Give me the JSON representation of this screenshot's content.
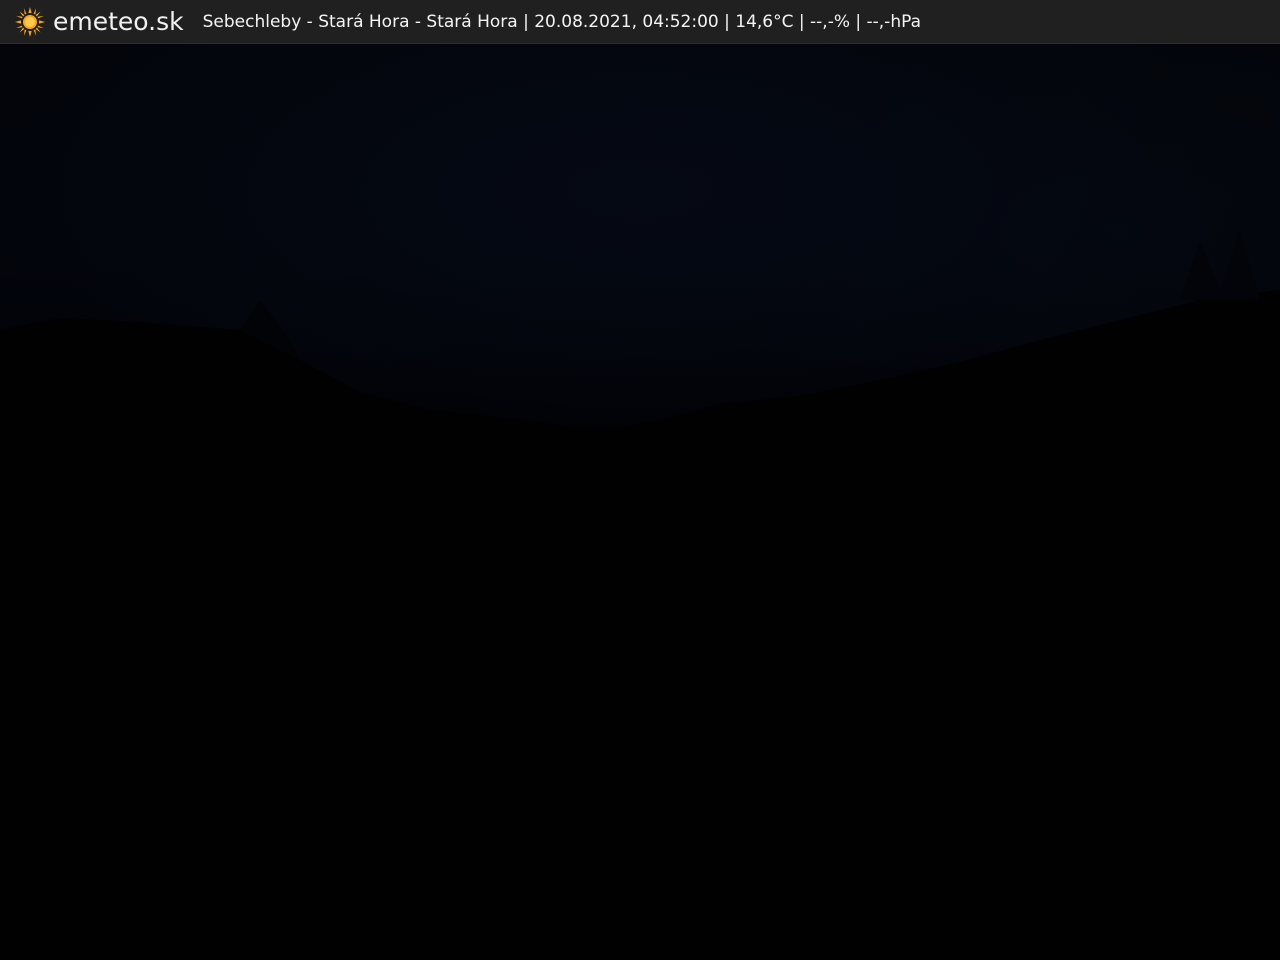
{
  "overlay": {
    "brand": "emeteo.sk",
    "logo_icon": "sun-icon",
    "caption": "Sebechleby - Stará Hora - Stará Hora | 20.08.2021, 04:52:00 | 14,6°C | --,-% | --,-hPa",
    "logo_color": "#f5a623"
  },
  "scene": {
    "subject": "night webcam view, dark sky over horizon"
  }
}
